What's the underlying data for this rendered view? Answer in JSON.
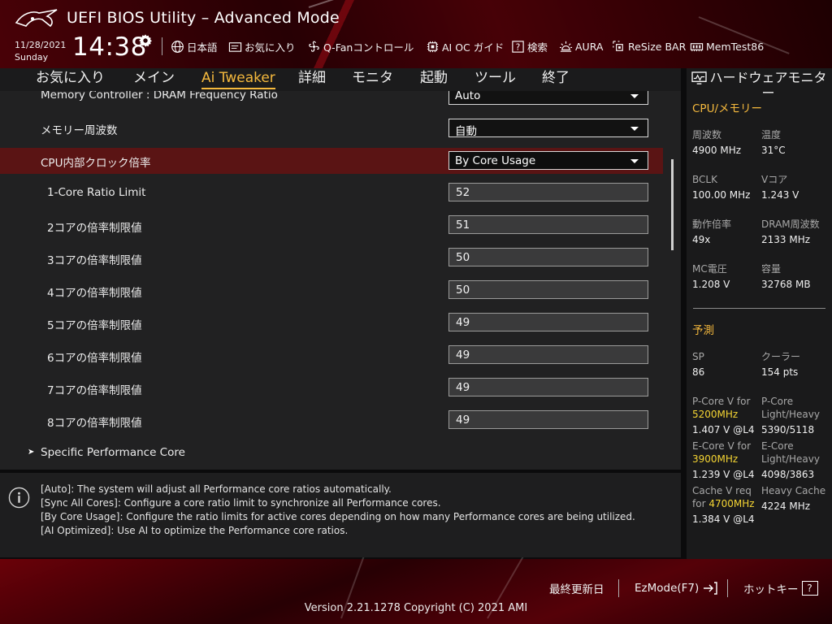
{
  "header": {
    "title": "UEFI BIOS Utility – Advanced Mode",
    "date": "11/28/2021",
    "day": "Sunday",
    "time": "14:38"
  },
  "toolbar": [
    {
      "name": "language-button",
      "icon": "globe-icon",
      "label": "日本語"
    },
    {
      "name": "favorites-button",
      "icon": "folder-star-icon",
      "label": "お気に入り"
    },
    {
      "name": "qfan-button",
      "icon": "fan-icon",
      "label": "Q-Fanコントロール"
    },
    {
      "name": "ai-oc-guide-button",
      "icon": "chip-icon",
      "label": "AI OC ガイド"
    },
    {
      "name": "search-button",
      "icon": "question-box-icon",
      "label": "検索"
    },
    {
      "name": "aura-button",
      "icon": "aura-light-icon",
      "label": "AURA"
    },
    {
      "name": "resize-bar-button",
      "icon": "resize-bar-icon",
      "label": "ReSize BAR"
    },
    {
      "name": "memtest-button",
      "icon": "memory-icon",
      "label": "MemTest86"
    }
  ],
  "nav": {
    "tabs": [
      {
        "label": "お気に入り",
        "active": false
      },
      {
        "label": "メイン",
        "active": false
      },
      {
        "label": "Ai Tweaker",
        "active": true
      },
      {
        "label": "詳細",
        "active": false
      },
      {
        "label": "モニタ",
        "active": false
      },
      {
        "label": "起動",
        "active": false
      },
      {
        "label": "ツール",
        "active": false
      },
      {
        "label": "終了",
        "active": false
      }
    ]
  },
  "settings": {
    "memory_ratio": {
      "label": "Memory Controller : DRAM Frequency Ratio",
      "value": "Auto"
    },
    "memory_freq": {
      "label": "メモリー周波数",
      "value": "自動"
    },
    "cpu_ratio": {
      "label": "CPU内部クロック倍率",
      "value": "By Core Usage"
    },
    "core_limits": [
      {
        "label": "1-Core Ratio Limit",
        "value": "52"
      },
      {
        "label": "2コアの倍率制限値",
        "value": "51"
      },
      {
        "label": "3コアの倍率制限値",
        "value": "50"
      },
      {
        "label": "4コアの倍率制限値",
        "value": "50"
      },
      {
        "label": "5コアの倍率制限値",
        "value": "49"
      },
      {
        "label": "6コアの倍率制限値",
        "value": "49"
      },
      {
        "label": "7コアの倍率制限値",
        "value": "49"
      },
      {
        "label": "8コアの倍率制限値",
        "value": "49"
      }
    ],
    "submenu": {
      "label": "Specific Performance Core"
    }
  },
  "help": {
    "lines": [
      "[Auto]: The system will adjust all Performance core ratios automatically.",
      "[Sync All Cores]: Configure a core ratio limit to synchronize all Performance cores.",
      "[By Core Usage]: Configure the ratio limits for active cores depending on how many Performance cores are being utilized.",
      "[AI Optimized]: Use AI to optimize the Performance core ratios."
    ]
  },
  "hw_monitor": {
    "title": "ハードウェアモニター",
    "cpu_section": "CPU/メモリー",
    "freq_label": "周波数",
    "freq_value": "4900 MHz",
    "temp_label": "温度",
    "temp_value": "31°C",
    "bclk_label": "BCLK",
    "bclk_value": "100.00 MHz",
    "vcore_label": "Vコア",
    "vcore_value": "1.243 V",
    "ratio_label": "動作倍率",
    "ratio_value": "49x",
    "dram_label": "DRAM周波数",
    "dram_value": "2133 MHz",
    "mc_label": "MC電圧",
    "mc_value": "1.208 V",
    "cap_label": "容量",
    "cap_value": "32768 MB",
    "predict_section": "予測",
    "sp_label": "SP",
    "sp_value": "86",
    "cooler_label": "クーラー",
    "cooler_value": "154 pts",
    "pcore_v_label": "P-Core V for",
    "pcore_v_freq": "5200MHz",
    "pcore_v_value": "1.407 V @L4",
    "pcore_lh_label_1": "P-Core",
    "pcore_lh_label_2": "Light/Heavy",
    "pcore_lh_value": "5390/5118",
    "ecore_v_label": "E-Core V for",
    "ecore_v_freq": "3900MHz",
    "ecore_v_value": "1.239 V @L4",
    "ecore_lh_label_1": "E-Core",
    "ecore_lh_label_2": "Light/Heavy",
    "ecore_lh_value": "4098/3863",
    "cache_v_label_1": "Cache V req",
    "cache_v_label_2": "for",
    "cache_v_freq": "4700MHz",
    "cache_v_value": "1.384 V @L4",
    "heavy_cache_label": "Heavy Cache",
    "heavy_cache_value": "4224 MHz"
  },
  "footer": {
    "last_modified": "最終更新日",
    "ezmode": "EzMode(F7)",
    "hotkeys": "ホットキー",
    "hotkeys_key": "?",
    "version": "Version 2.21.1278 Copyright (C) 2021 AMI"
  },
  "colors": {
    "accent": "#f5b93d",
    "selected_row": "#5a1414",
    "highlight": "#f5d533"
  }
}
